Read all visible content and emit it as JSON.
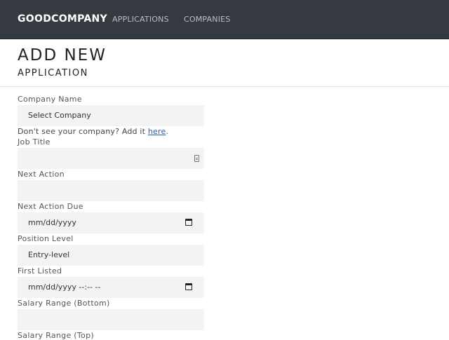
{
  "navbar": {
    "brand": "GOODCOMPANY",
    "links": [
      "APPLICATIONS",
      "COMPANIES"
    ]
  },
  "page": {
    "title": "ADD NEW",
    "subtitle": "APPLICATION"
  },
  "form": {
    "company": {
      "label": "Company Name",
      "value": "Select Company",
      "helper_text": "Don't see your company? Add it ",
      "helper_link": "here",
      "helper_end": "."
    },
    "job_title": {
      "label": "Job Title",
      "value": ""
    },
    "next_action": {
      "label": "Next Action",
      "value": ""
    },
    "next_action_due": {
      "label": "Next Action Due",
      "placeholder": "mm/dd/yyyy"
    },
    "position_level": {
      "label": "Position Level",
      "value": "Entry-level"
    },
    "first_listed": {
      "label": "First Listed",
      "placeholder": "mm/dd/yyyy --:-- --"
    },
    "salary_bottom": {
      "label": "Salary Range (Bottom)",
      "value": ""
    },
    "salary_top": {
      "label": "Salary Range (Top)"
    }
  },
  "icons": {
    "calendar": "calendar-icon",
    "autofill": "contact-card-icon"
  }
}
